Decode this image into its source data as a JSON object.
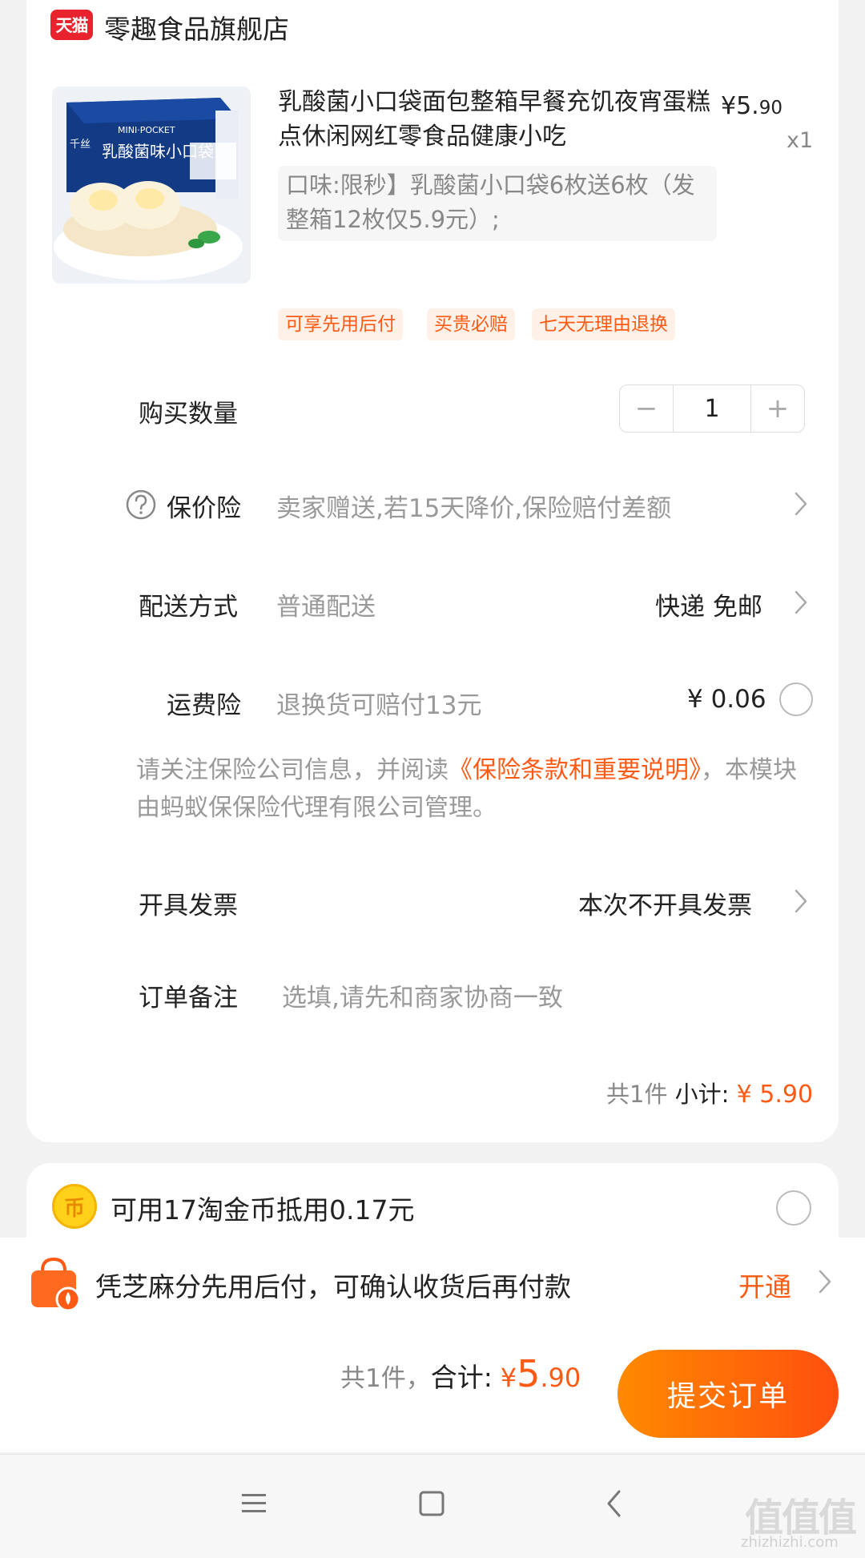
{
  "colors": {
    "accent": "#ff5a14",
    "tmall_red": "#e8232e",
    "submit_from": "#ff8a00",
    "submit_to": "#ff4f0f"
  },
  "store": {
    "badge": "天猫",
    "name": "零趣食品旗舰店"
  },
  "product": {
    "title": "乳酸菌小口袋面包整箱早餐充饥夜宵蛋糕点休闲网红零食品健康小吃",
    "price_symbol": "¥",
    "price_int": "5.",
    "price_dec": "90",
    "quantity_label": "x1",
    "sku": "口味:限秒】乳酸菌小口袋6枚送6枚（发整箱12枚仅5.9元）;",
    "image_text": {
      "brand": "千丝",
      "en": "MINI·POCKET",
      "cn": "乳酸菌味小口袋"
    },
    "tags": [
      "可享先用后付",
      "买贵必赔",
      "七天无理由退换"
    ]
  },
  "quantity": {
    "label": "购买数量",
    "minus": "−",
    "value": "1",
    "plus": "+"
  },
  "price_protection": {
    "label": "保价险",
    "icon": "question-circle-icon",
    "desc": "卖家赠送,若15天降价,保险赔付差额"
  },
  "delivery": {
    "label": "配送方式",
    "method": "普通配送",
    "value": "快递 免邮"
  },
  "shipping_insurance": {
    "label": "运费险",
    "desc": "退换货可赔付13元",
    "price": "¥ 0.06"
  },
  "notice": {
    "before": "请关注保险公司信息，并阅读",
    "link": "《保险条款和重要说明》",
    "after": "，本模块由蚂蚁保保险代理有限公司管理。"
  },
  "invoice": {
    "label": "开具发票",
    "value": "本次不开具发票"
  },
  "remark": {
    "label": "订单备注",
    "placeholder": "选填,请先和商家协商一致"
  },
  "subtotal": {
    "count": "共1件",
    "label": "小计:",
    "amount": "¥ 5.90"
  },
  "coins": {
    "icon_glyph": "币",
    "text": "可用17淘金币抵用0.17元"
  },
  "pay_later": {
    "text": "凭芝麻分先用后付，可确认收货后再付款",
    "link": "开通"
  },
  "total": {
    "count": "共1件，",
    "label": "合计:",
    "symbol": "¥",
    "int": "5",
    "dec": ".90"
  },
  "submit_label": "提交订单",
  "watermark": {
    "main": "值值值",
    "sub": "zhizhizhi.com"
  }
}
